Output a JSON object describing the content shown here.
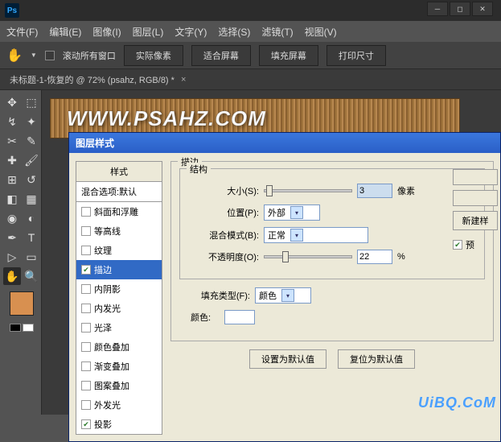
{
  "app": {
    "logo": "Ps"
  },
  "menu": {
    "file": "文件(F)",
    "edit": "编辑(E)",
    "image": "图像(I)",
    "layer": "图层(L)",
    "type": "文字(Y)",
    "select": "选择(S)",
    "filter": "滤镜(T)",
    "view": "视图(V)"
  },
  "options": {
    "scroll_all": "滚动所有窗口",
    "actual_pixels": "实际像素",
    "fit_screen": "适合屏幕",
    "fill_screen": "填充屏幕",
    "print_size": "打印尺寸"
  },
  "document": {
    "tab_title": "未标题-1-恢复的 @ 72% (psahz, RGB/8) *"
  },
  "banner": {
    "text": "WWW.PSAHZ.COM"
  },
  "dialog": {
    "title": "图层样式",
    "styles_header": "样式",
    "blend_default": "混合选项:默认",
    "styles": {
      "bevel": "斜面和浮雕",
      "contour": "等高线",
      "texture": "纹理",
      "stroke": "描边",
      "inner_shadow": "内阴影",
      "inner_glow": "内发光",
      "satin": "光泽",
      "color_overlay": "颜色叠加",
      "gradient_overlay": "渐变叠加",
      "pattern_overlay": "图案叠加",
      "outer_glow": "外发光",
      "drop_shadow": "投影"
    },
    "stroke": {
      "group_label": "描边",
      "structure_label": "结构",
      "size_label": "大小(S):",
      "size_value": "3",
      "size_unit": "像素",
      "position_label": "位置(P):",
      "position_value": "外部",
      "blend_label": "混合模式(B):",
      "blend_value": "正常",
      "opacity_label": "不透明度(O):",
      "opacity_value": "22",
      "opacity_unit": "%",
      "fill_type_label": "填充类型(F):",
      "fill_type_value": "颜色",
      "color_label": "颜色:"
    },
    "buttons": {
      "set_default": "设置为默认值",
      "reset_default": "复位为默认值",
      "new_style": "新建样",
      "preview": "预"
    }
  },
  "watermark": "UiBQ.CoM"
}
